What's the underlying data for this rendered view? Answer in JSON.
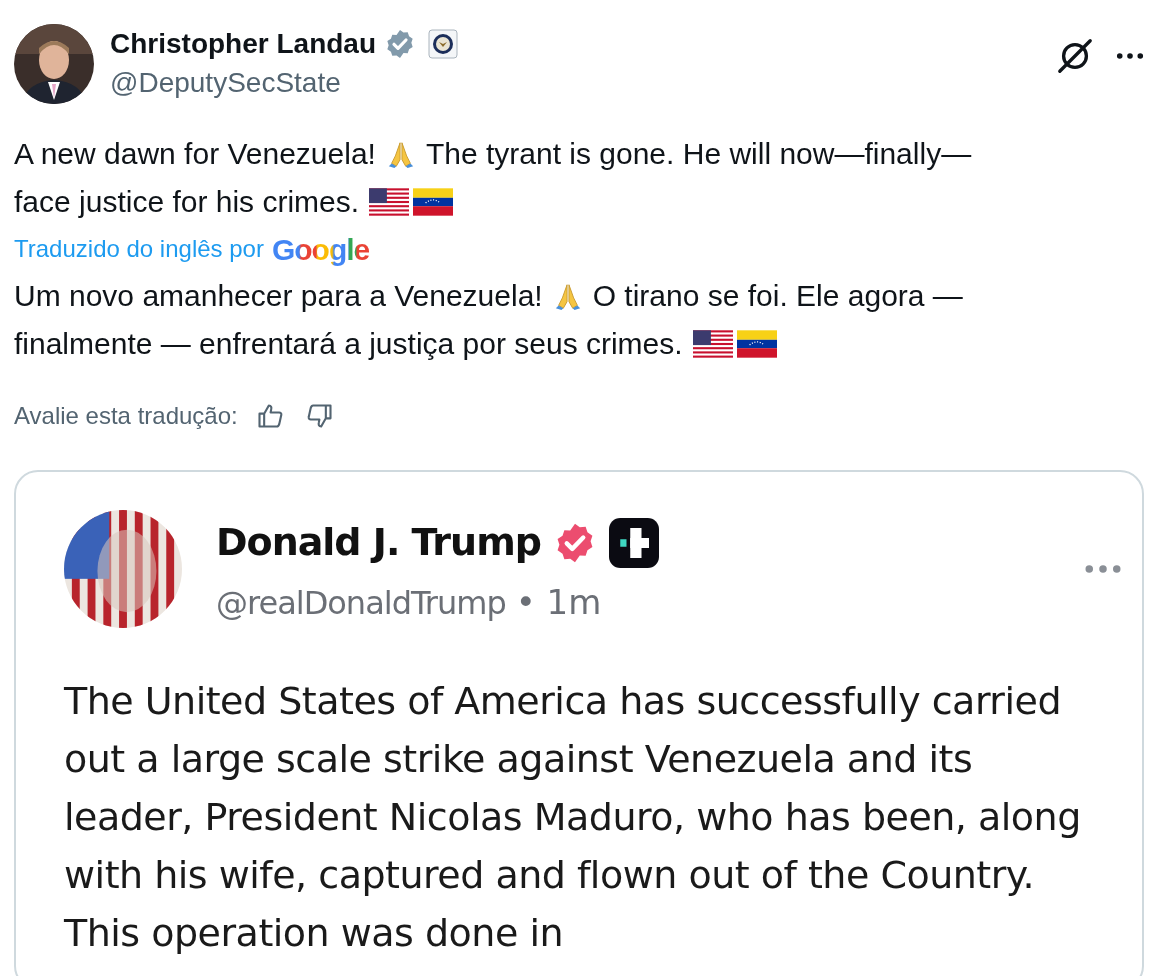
{
  "author": {
    "name": "Christopher Landau",
    "handle": "@DeputySecState",
    "verified": true
  },
  "text_parts": [
    "A new dawn for Venezuela!",
    "The tyrant is gone. He will now—finally—",
    "face justice for his crimes."
  ],
  "translation": {
    "label": "Traduzido do inglês por",
    "provider": "Google",
    "text_parts": [
      "Um novo amanhecer para a Venezuela!",
      "O tirano se foi. Ele agora —",
      "finalmente — enfrentará a justiça por seus crimes."
    ],
    "rate_label": "Avalie esta tradução:"
  },
  "quoted_image": {
    "name": "Donald J. Trump",
    "verified": true,
    "handle": "@realDonaldTrump",
    "time": "• 1m",
    "text": "The United States of America has successfully carried out a large scale strike against Venezuela and its leader, President Nicolas Maduro, who has been, along with his wife, captured and flown out of the Country. This operation was done in"
  }
}
